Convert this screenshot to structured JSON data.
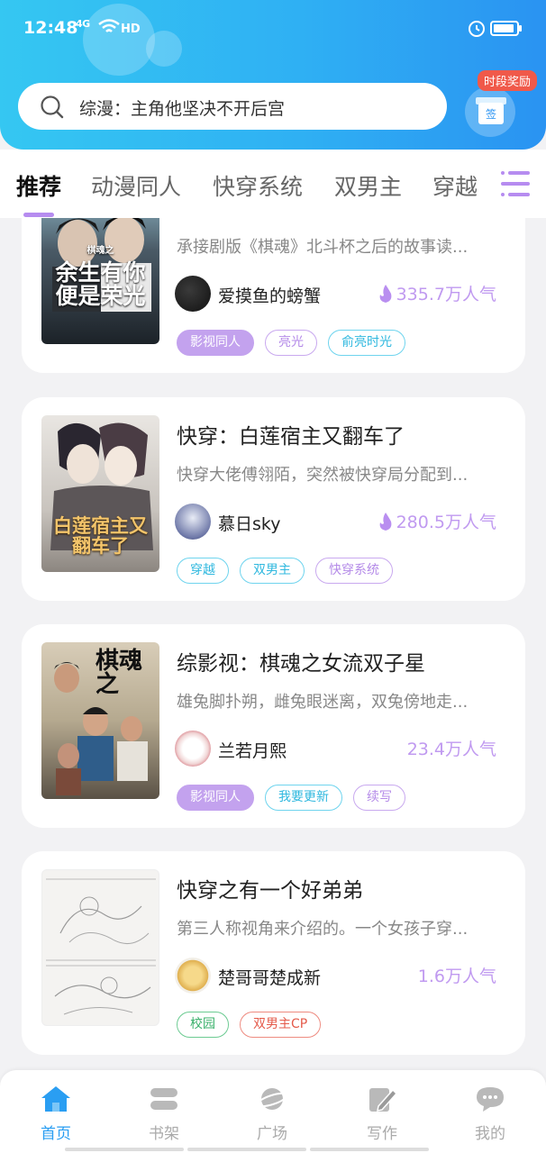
{
  "status_bar": {
    "time": "12:48",
    "network": "4G",
    "hd": "HD"
  },
  "search": {
    "placeholder": "综漫：主角他坚决不开后宫"
  },
  "reward": {
    "badge": "时段奖励",
    "gift_label": "签"
  },
  "tabs": [
    {
      "label": "推荐",
      "active": true
    },
    {
      "label": "动漫同人",
      "active": false
    },
    {
      "label": "快穿系统",
      "active": false
    },
    {
      "label": "双男主",
      "active": false
    },
    {
      "label": "穿越",
      "active": false
    }
  ],
  "books": [
    {
      "title": "",
      "description": "承接剧版《棋魂》北斗杯之后的故事读...",
      "cover_text": "余生有你便是荣光",
      "cover_subtext": "棋魂之",
      "author": "爱摸鱼的螃蟹",
      "popularity": "335.7万人气",
      "hot": true,
      "tags": [
        {
          "label": "影视同人",
          "style": "filled"
        },
        {
          "label": "亮光",
          "style": "purple"
        },
        {
          "label": "俞亮时光",
          "style": "cyan"
        }
      ]
    },
    {
      "title": "快穿：白莲宿主又翻车了",
      "description": "快穿大佬傅翎陌，突然被快穿局分配到...",
      "cover_text": "白莲宿主又翻车了",
      "author": "慕日sky",
      "popularity": "280.5万人气",
      "hot": true,
      "tags": [
        {
          "label": "穿越",
          "style": "cyan"
        },
        {
          "label": "双男主",
          "style": "cyan"
        },
        {
          "label": "快穿系统",
          "style": "purple"
        }
      ]
    },
    {
      "title": "综影视：棋魂之女流双子星",
      "description": "雄兔脚扑朔，雌兔眼迷离，双兔傍地走...",
      "cover_text": "棋魂之",
      "author": "兰若月熙",
      "popularity": "23.4万人气",
      "hot": false,
      "tags": [
        {
          "label": "影视同人",
          "style": "filled"
        },
        {
          "label": "我要更新",
          "style": "cyan"
        },
        {
          "label": "续写",
          "style": "purple"
        }
      ]
    },
    {
      "title": "快穿之有一个好弟弟",
      "description": "第三人称视角来介绍的。一个女孩子穿...",
      "cover_text": "",
      "author": "楚哥哥楚成新",
      "popularity": "1.6万人气",
      "hot": false,
      "tags": [
        {
          "label": "校园",
          "style": "green"
        },
        {
          "label": "双男主CP",
          "style": "red"
        }
      ]
    }
  ],
  "bottom_nav": [
    {
      "label": "首页",
      "icon": "home-icon",
      "active": true
    },
    {
      "label": "书架",
      "icon": "bookshelf-icon",
      "active": false
    },
    {
      "label": "广场",
      "icon": "planet-icon",
      "active": false
    },
    {
      "label": "写作",
      "icon": "pen-icon",
      "active": false
    },
    {
      "label": "我的",
      "icon": "chat-icon",
      "active": false
    }
  ],
  "colors": {
    "accent": "#2a9ef2",
    "purple": "#b68cf0",
    "popularity": "#c09af0"
  }
}
